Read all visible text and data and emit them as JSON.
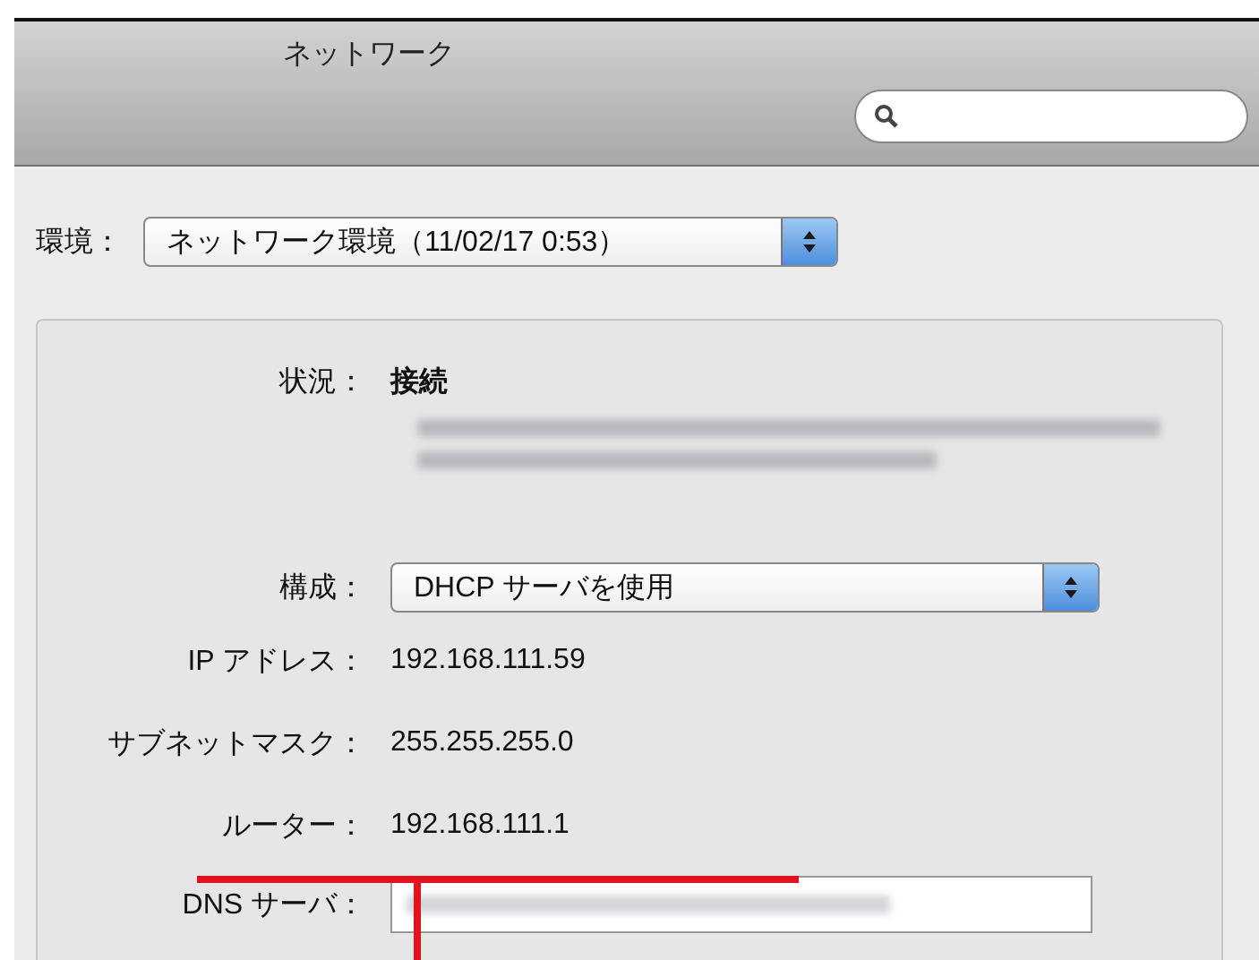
{
  "window": {
    "title": "ネットワーク"
  },
  "location": {
    "label": "環境：",
    "value": "ネットワーク環境（11/02/17 0:53）"
  },
  "status": {
    "label": "状況：",
    "value": "接続"
  },
  "config": {
    "label": "構成：",
    "value": "DHCP サーバを使用"
  },
  "info_rows": [
    {
      "label": "IP アドレス：",
      "value": "192.168.111.59"
    },
    {
      "label": "サブネットマスク：",
      "value": "255.255.255.0"
    },
    {
      "label": "ルーター：",
      "value": "192.168.111.1"
    }
  ],
  "dns": {
    "label": "DNS サーバ："
  }
}
